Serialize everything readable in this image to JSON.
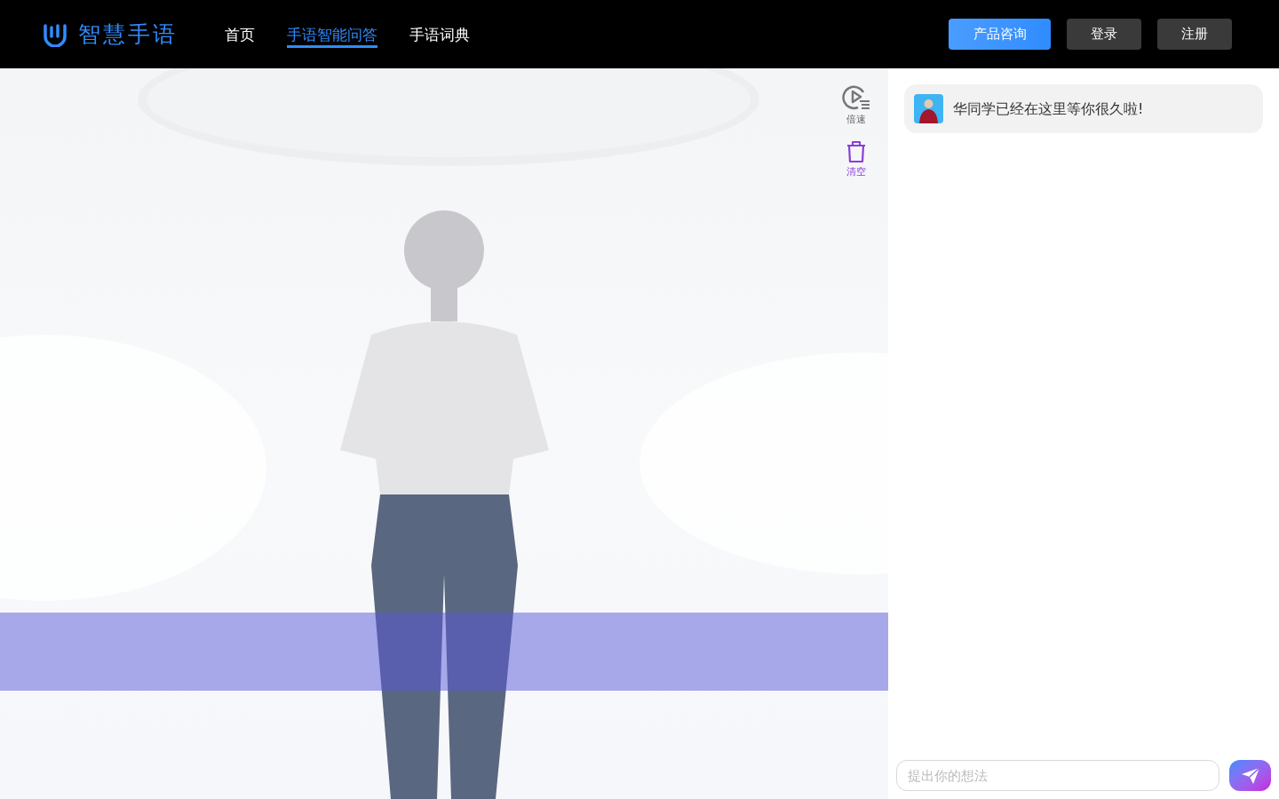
{
  "brand": {
    "name": "智慧手语"
  },
  "nav": [
    {
      "label": "首页",
      "selected": false
    },
    {
      "label": "手语智能问答",
      "selected": true
    },
    {
      "label": "手语词典",
      "selected": false
    }
  ],
  "header_buttons": [
    {
      "label": "产品咨询",
      "kind": "primary"
    },
    {
      "label": "登录",
      "kind": "dark"
    },
    {
      "label": "注册",
      "kind": "dark"
    }
  ],
  "stage_tools": [
    {
      "label": "倍速",
      "kind": "speed"
    },
    {
      "label": "清空",
      "kind": "clear"
    }
  ],
  "chat": {
    "messages": [
      {
        "text": "华同学已经在这里等你很久啦!"
      }
    ],
    "input": {
      "placeholder": "提出你的想法"
    }
  }
}
